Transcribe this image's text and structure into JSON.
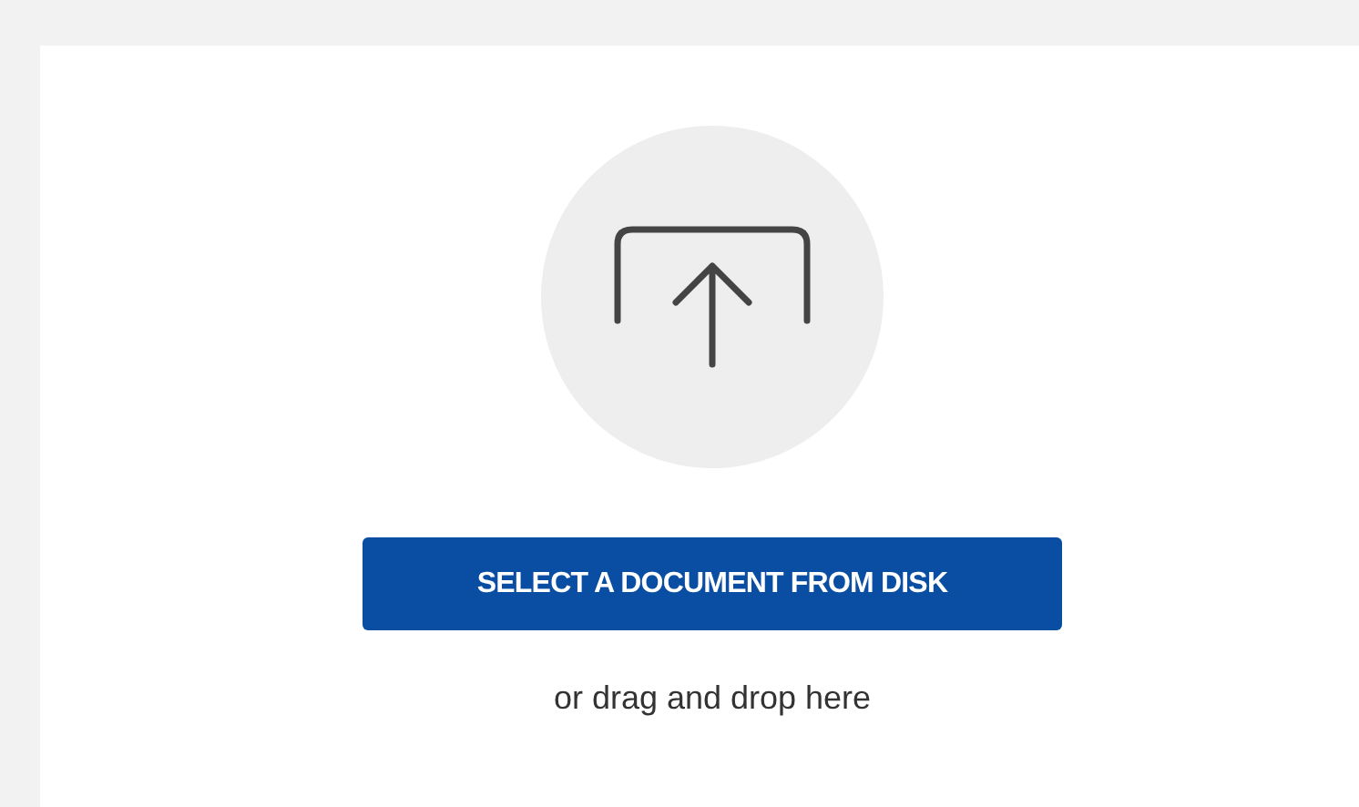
{
  "upload": {
    "button": "SELECT A DOCUMENT FROM DISK",
    "hint": "or drag and drop here"
  }
}
